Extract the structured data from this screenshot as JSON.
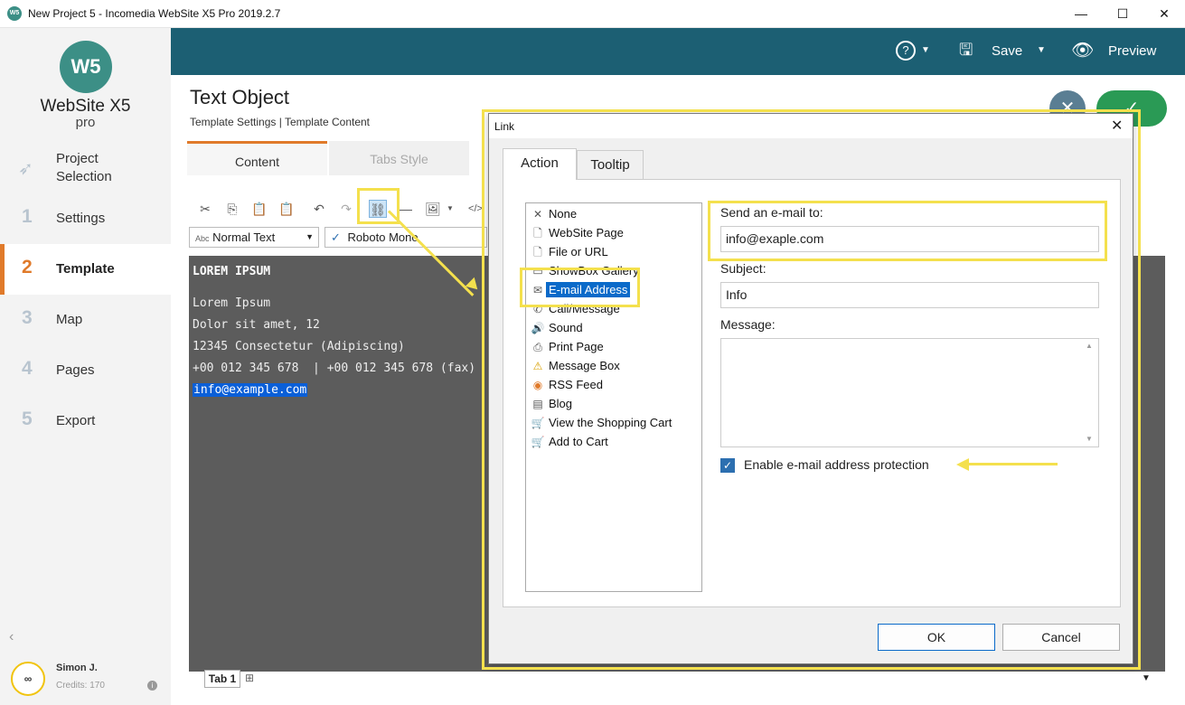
{
  "window": {
    "title": "New Project 5 - Incomedia WebSite X5 Pro 2019.2.7",
    "app_icon": "W5",
    "minimize": "—",
    "maximize": "☐",
    "close": "✕"
  },
  "sidebar": {
    "logo_mark": "W5",
    "logo_text": "WebSite X5",
    "logo_sub": "pro",
    "items": [
      {
        "num": "",
        "label": "Project Selection"
      },
      {
        "num": "1",
        "label": "Settings"
      },
      {
        "num": "2",
        "label": "Template"
      },
      {
        "num": "3",
        "label": "Map"
      },
      {
        "num": "4",
        "label": "Pages"
      },
      {
        "num": "5",
        "label": "Export"
      }
    ],
    "collapse": "‹",
    "user": {
      "avatar": "∞",
      "name": "Simon J.",
      "credits": "Credits: 170",
      "info": "i"
    }
  },
  "topbar": {
    "help": "?",
    "save_label": "Save",
    "preview_label": "Preview"
  },
  "main": {
    "title": "Text Object",
    "breadcrumb": "Template Settings | Template Content",
    "cancel_glyph": "✕",
    "confirm_glyph": "✓",
    "tabs": [
      {
        "label": "Content"
      },
      {
        "label": "Tabs Style"
      }
    ],
    "style_select_prefix": "Abc",
    "style_select": "Normal Text",
    "font_select_prefix": "✓",
    "font_select": "Roboto Mono",
    "editor_lines": [
      "LOREM IPSUM",
      "Lorem Ipsum",
      "Dolor sit amet, 12",
      "12345 Consectetur (Adipiscing)",
      "+00 012 345 678  | +00 012 345 678 (fax)",
      "info@example.com"
    ],
    "bottom_tab": "Tab 1"
  },
  "dialog": {
    "title": "Link",
    "close": "✕",
    "tabs": [
      "Action",
      "Tooltip"
    ],
    "actions": [
      {
        "icon": "✕",
        "label": "None"
      },
      {
        "icon": "🗋",
        "label": "WebSite Page"
      },
      {
        "icon": "🗋",
        "label": "File or URL"
      },
      {
        "icon": "▭",
        "label": "ShowBox Gallery"
      },
      {
        "icon": "✉",
        "label": "E-mail Address"
      },
      {
        "icon": "✆",
        "label": "Call/Message"
      },
      {
        "icon": "🔊",
        "label": "Sound"
      },
      {
        "icon": "⎙",
        "label": "Print Page"
      },
      {
        "icon": "⚠",
        "label": "Message Box"
      },
      {
        "icon": "◉",
        "label": "RSS Feed"
      },
      {
        "icon": "▤",
        "label": "Blog"
      },
      {
        "icon": "🛒",
        "label": "View the Shopping Cart"
      },
      {
        "icon": "🛒",
        "label": "Add to Cart"
      }
    ],
    "selected_action_index": 4,
    "send_to_label": "Send an e-mail to:",
    "send_to_value": "info@exaple.com",
    "subject_label": "Subject:",
    "subject_value": "Info",
    "message_label": "Message:",
    "message_value": "",
    "protection_label": "Enable e-mail address protection",
    "protection_checked": true,
    "ok_label": "OK",
    "cancel_label": "Cancel"
  },
  "colors": {
    "accent": "#e07a2a",
    "topbar": "#1c5f73",
    "brand": "#3c8f86",
    "annotation": "#f4e04d",
    "selection": "#0a6ac9"
  }
}
